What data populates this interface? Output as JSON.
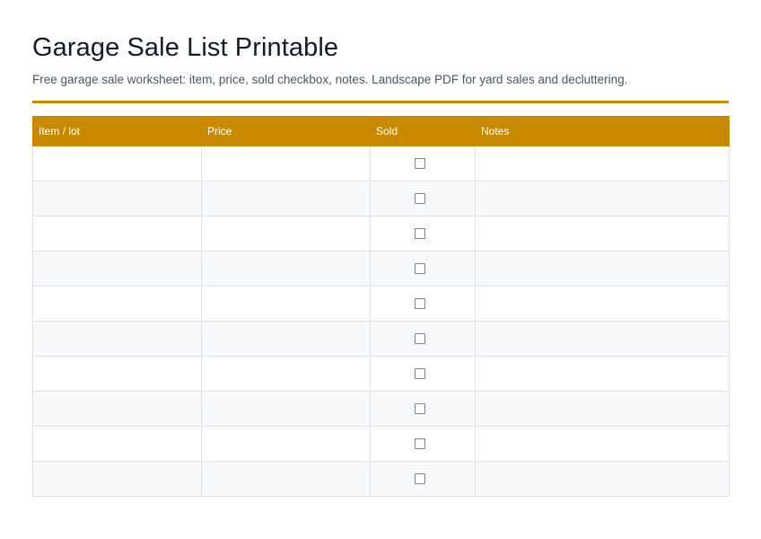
{
  "document": {
    "title": "Garage Sale List Printable",
    "subtitle": "Free garage sale worksheet: item, price, sold checkbox, notes. Landscape PDF for yard sales and decluttering.",
    "accent_color": "#c98a00"
  },
  "table": {
    "headers": {
      "item": "Item / lot",
      "price": "Price",
      "sold": "Sold",
      "notes": "Notes"
    },
    "rows": [
      {
        "item": "",
        "price": "",
        "sold": false,
        "notes": ""
      },
      {
        "item": "",
        "price": "",
        "sold": false,
        "notes": ""
      },
      {
        "item": "",
        "price": "",
        "sold": false,
        "notes": ""
      },
      {
        "item": "",
        "price": "",
        "sold": false,
        "notes": ""
      },
      {
        "item": "",
        "price": "",
        "sold": false,
        "notes": ""
      },
      {
        "item": "",
        "price": "",
        "sold": false,
        "notes": ""
      },
      {
        "item": "",
        "price": "",
        "sold": false,
        "notes": ""
      },
      {
        "item": "",
        "price": "",
        "sold": false,
        "notes": ""
      },
      {
        "item": "",
        "price": "",
        "sold": false,
        "notes": ""
      },
      {
        "item": "",
        "price": "",
        "sold": false,
        "notes": ""
      }
    ],
    "checkbox_icon": "checkbox-empty-icon"
  }
}
